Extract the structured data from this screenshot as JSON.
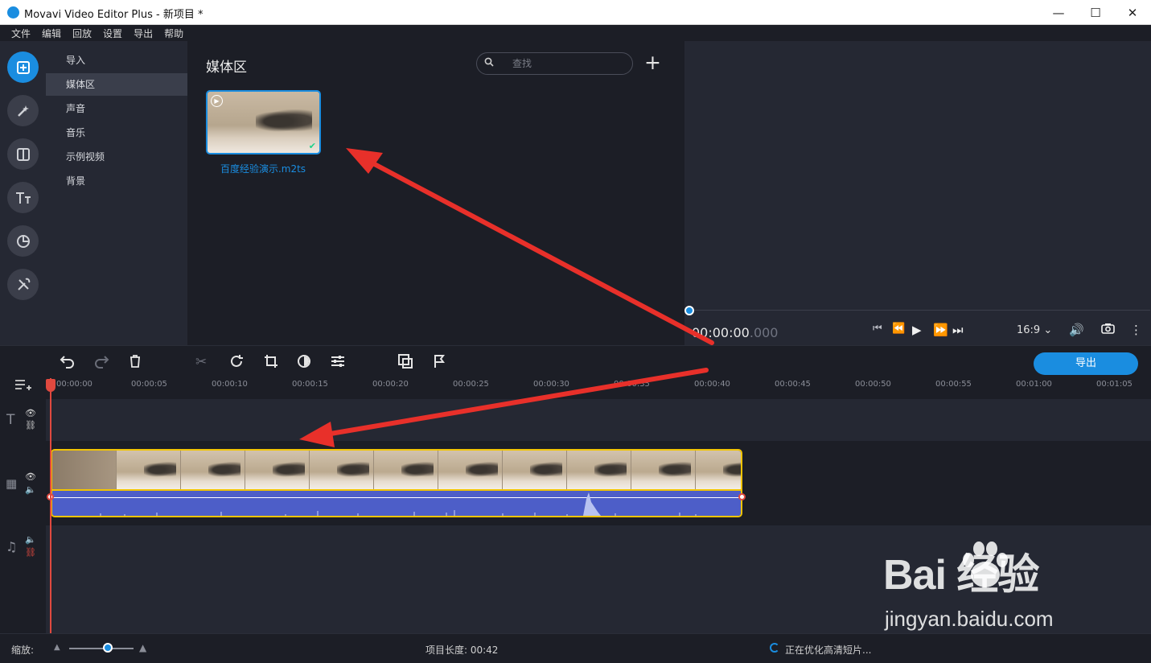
{
  "window": {
    "title": "Movavi Video Editor Plus - 新项目 *",
    "minimize": "—",
    "maximize": "☐",
    "close": "✕"
  },
  "menu": [
    "文件",
    "编辑",
    "回放",
    "设置",
    "导出",
    "帮助"
  ],
  "rail_icons": [
    "import-icon",
    "magic-wand-icon",
    "transition-icon",
    "titles-icon",
    "sticker-icon",
    "tools-icon"
  ],
  "categories": [
    "导入",
    "媒体区",
    "声音",
    "音乐",
    "示例视频",
    "背景"
  ],
  "selected_category": "媒体区",
  "media": {
    "heading": "媒体区",
    "search_placeholder": "查找",
    "file_name": "百度经验演示.m2ts"
  },
  "preview": {
    "timecode_main": "00:00:00",
    "timecode_ms": ".000",
    "aspect_ratio": "16:9 ⌄"
  },
  "toolbar": {
    "export_label": "导出"
  },
  "ruler": [
    "00:00:00",
    "00:00:05",
    "00:00:10",
    "00:00:15",
    "00:00:20",
    "00:00:25",
    "00:00:30",
    "00:00:35",
    "00:00:40",
    "00:00:45",
    "00:00:50",
    "00:00:55",
    "00:01:00",
    "00:01:05"
  ],
  "status": {
    "zoom_label": "缩放:",
    "project_length": "项目长度: 00:42",
    "optimizing": "正在优化高清短片..."
  },
  "watermark": {
    "logo": "Bai  经验",
    "url": "jingyan.baidu.com"
  },
  "colors": {
    "accent": "#1a8de0",
    "clip_border": "#f2c400",
    "audio": "#4d5ec8",
    "arrow": "#e8302a"
  }
}
